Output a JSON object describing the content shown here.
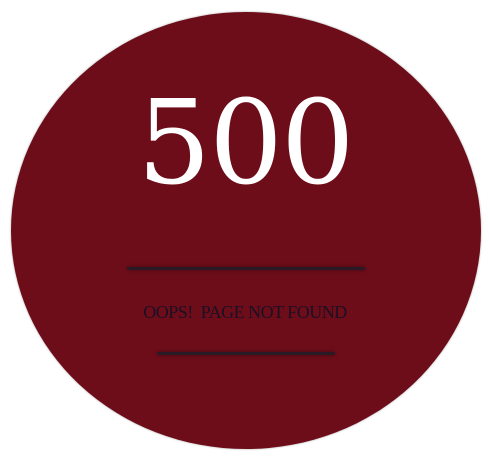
{
  "error": {
    "code": "500",
    "message": "OOPS!  PAGE NOT FOUND"
  },
  "colors": {
    "circle": "#6e0d1a",
    "code_text": "#ffffff",
    "message_text": "#1b1023",
    "rule": "#2a1a26",
    "background": "#ffffff"
  }
}
